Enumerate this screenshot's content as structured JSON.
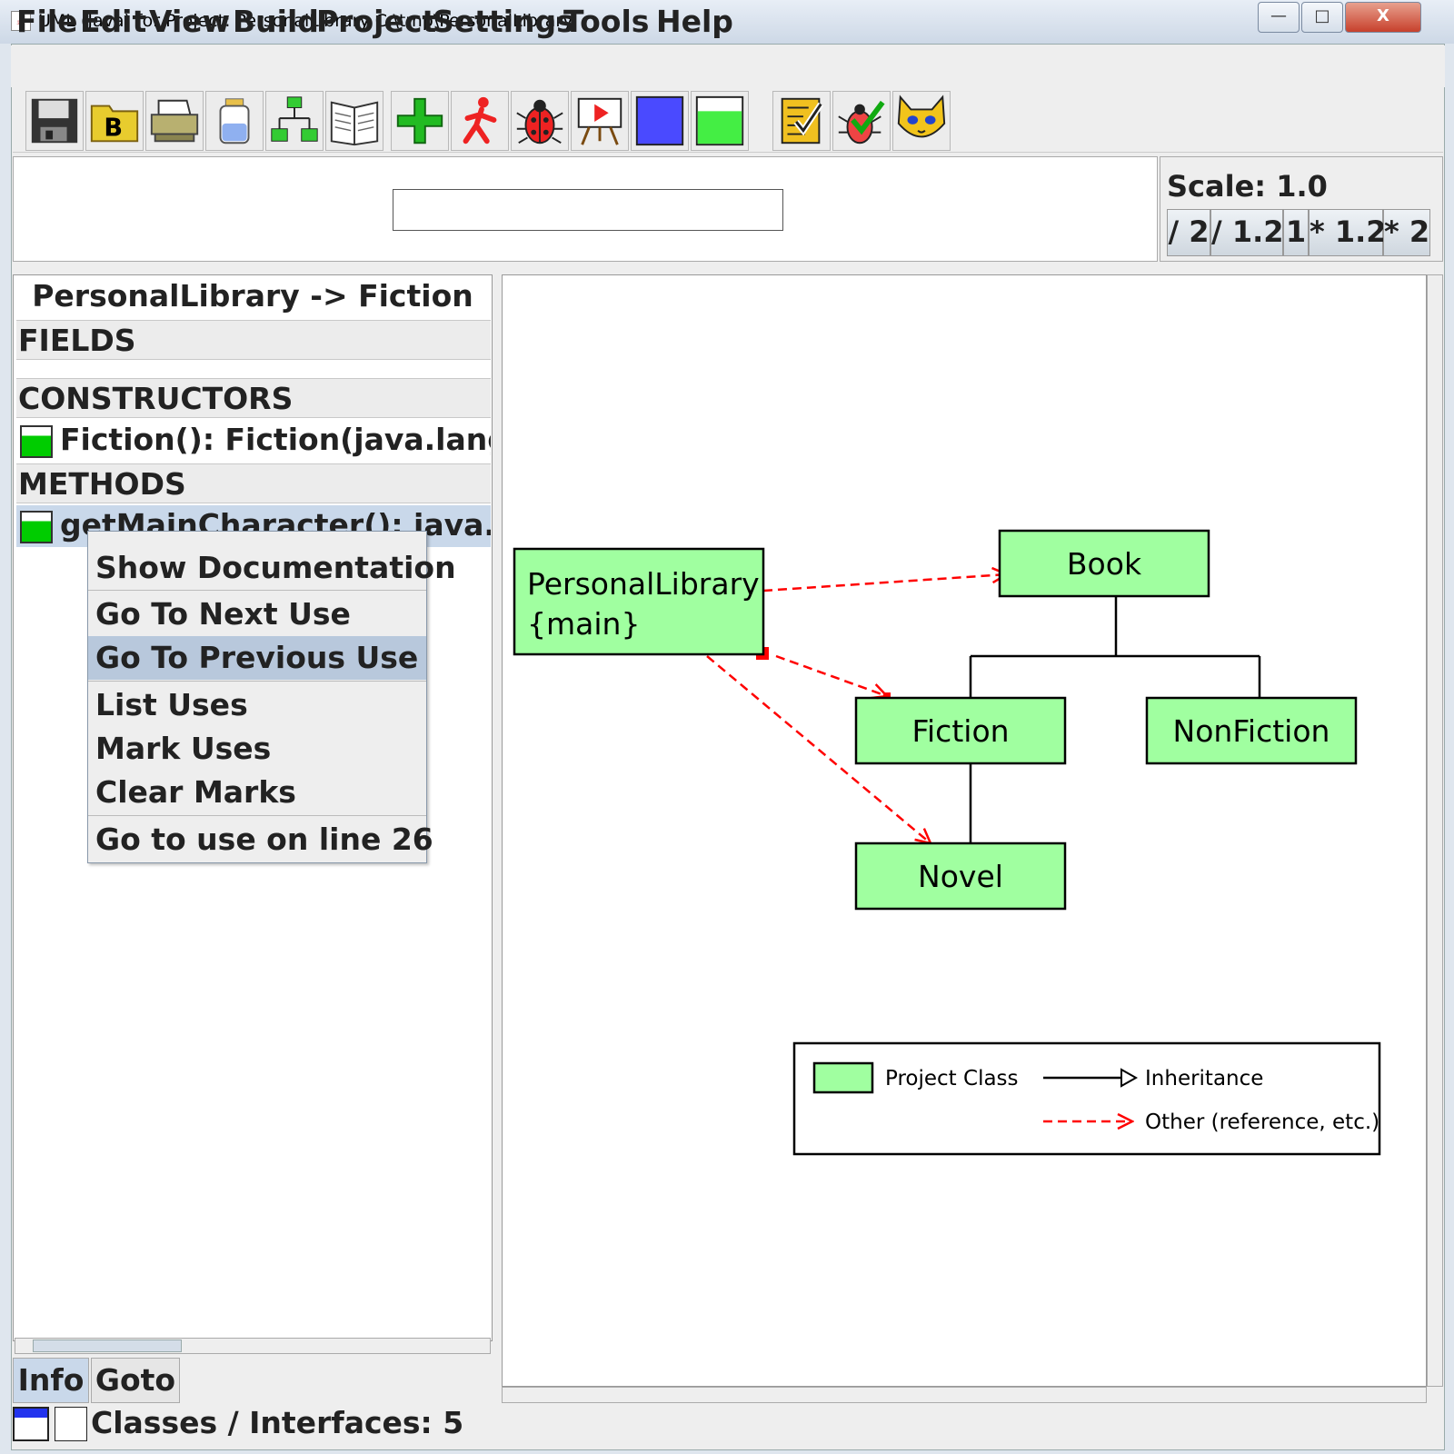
{
  "window": {
    "title": "UML (Java) for Project: PersonalLibrary  C:\\tmp\\PersonalLibrary",
    "minimize": "—",
    "maximize": "□",
    "close": "X"
  },
  "menu": {
    "file": "File",
    "edit": "Edit",
    "view": "View",
    "build": "Build",
    "project": "Project",
    "settings": "Settings",
    "tools": "Tools",
    "help": "Help"
  },
  "toolbar": {
    "icons": [
      "save-icon",
      "browse-icon",
      "print-icon",
      "jar-icon",
      "hierarchy-icon",
      "book-icon",
      "add-icon",
      "run-icon",
      "debug-icon",
      "applet-icon",
      "blue-square-icon",
      "green-square-icon",
      "checklist-icon",
      "debug-check-icon",
      "cat-icon"
    ],
    "save_letter": "B"
  },
  "scale": {
    "label": "Scale: 1.0",
    "buttons": [
      "/ 2",
      "/ 1.2",
      "1",
      "* 1.2",
      "* 2"
    ]
  },
  "info_panel": {
    "title": "PersonalLibrary -> Fiction",
    "fields_header": "FIELDS",
    "constructors_header": "CONSTRUCTORS",
    "constructor_row": "Fiction():  Fiction(java.lang.String",
    "methods_header": "METHODS",
    "method_row": "getMainCharacter():  java.lang.String"
  },
  "context_menu": {
    "items": [
      "Show Documentation",
      "Go To Next Use",
      "Go To Previous Use",
      "List Uses",
      "Mark Uses",
      "Clear Marks",
      "Go to use on line 26"
    ],
    "selected": "Go To Previous Use"
  },
  "tabs": {
    "info": "Info",
    "goto": "Goto"
  },
  "status": {
    "text": "Classes / Interfaces: 5"
  },
  "diagram": {
    "classes": {
      "personal_library": "PersonalLibrary",
      "personal_library_stereotype": "{main}",
      "book": "Book",
      "fiction": "Fiction",
      "nonfiction": "NonFiction",
      "novel": "Novel"
    },
    "legend": {
      "project_class": "Project Class",
      "inheritance": "Inheritance",
      "other": "Other (reference, etc.)"
    },
    "colors": {
      "class_fill": "#a0ffa0",
      "reference": "#ff0000"
    }
  }
}
